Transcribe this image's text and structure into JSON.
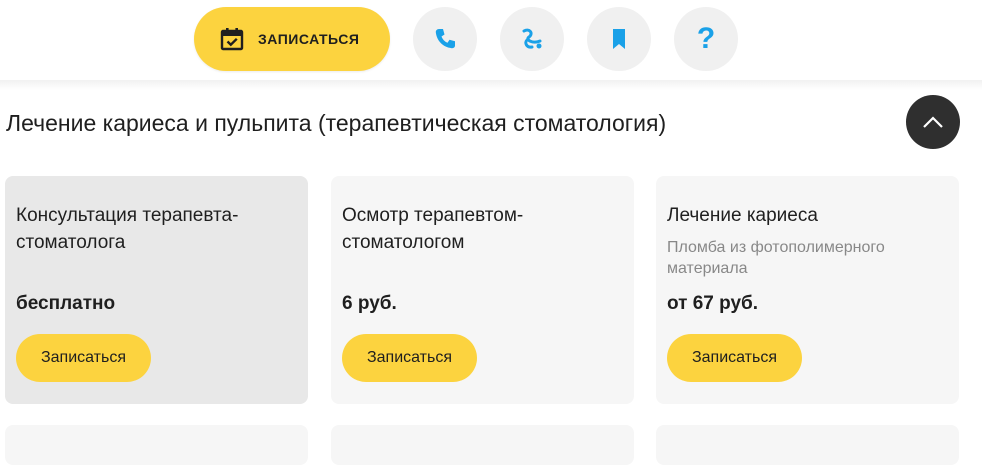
{
  "header": {
    "book_label": "ЗАПИСАТЬСЯ",
    "accent_color": "#fcd33f",
    "icon_color": "#1aa1e8",
    "icons": [
      "calendar-check-icon",
      "phone-icon",
      "route-icon",
      "bookmark-icon",
      "question-icon"
    ],
    "help_glyph": "?"
  },
  "section": {
    "title": "Лечение кариеса и пульпита (терапевтическая стоматология)"
  },
  "cards": [
    {
      "title": "Консультация терапевта-стоматолога",
      "subtitle": "",
      "price": "бесплатно",
      "button": "Записаться"
    },
    {
      "title": "Осмотр терапевтом-стоматологом",
      "subtitle": "",
      "price": "6 руб.",
      "button": "Записаться"
    },
    {
      "title": "Лечение кариеса",
      "subtitle": "Пломба из фотополимерного материала",
      "price": "от 67 руб.",
      "button": "Записаться"
    }
  ]
}
